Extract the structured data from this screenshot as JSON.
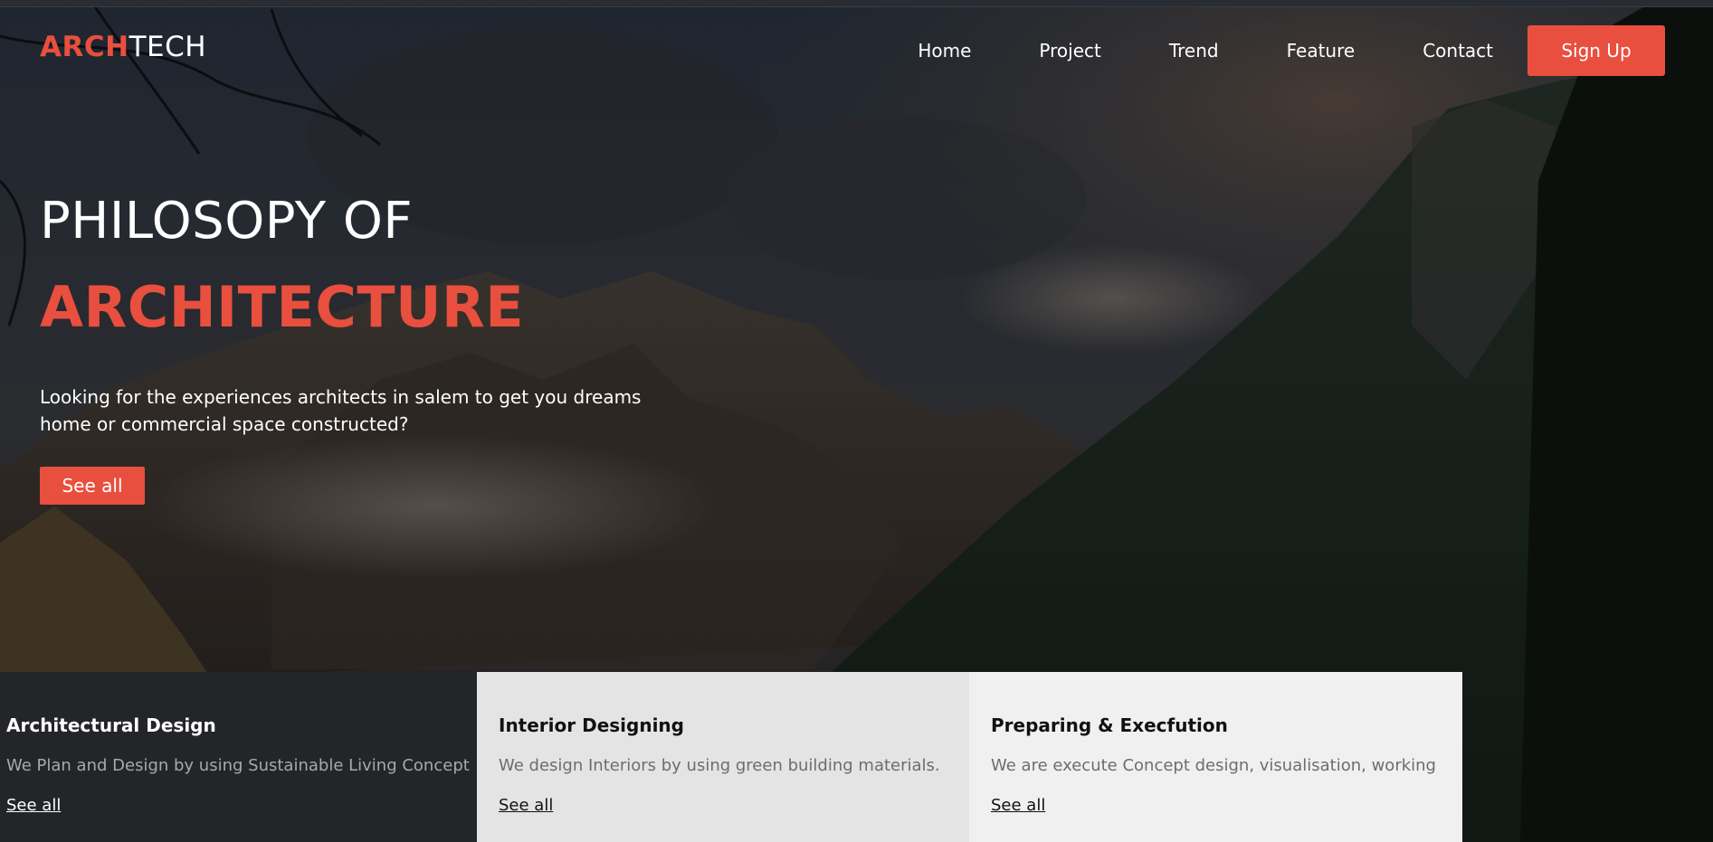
{
  "brand": {
    "accent_part": "ARCH",
    "rest_part": "TECH"
  },
  "nav": {
    "links": [
      "Home",
      "Project",
      "Trend",
      "Feature",
      "Contact"
    ],
    "signup_label": "Sign Up"
  },
  "hero": {
    "title_line1": "PHILOSOPY OF",
    "title_line2": "ARCHITECTURE",
    "description": "Looking for the experiences architects in salem to get you dreams home or commercial space constructed?",
    "button_label": "See all"
  },
  "services": [
    {
      "title": "Architectural Design",
      "text": "We Plan and Design by using Sustainable Living Concept",
      "link": "See all"
    },
    {
      "title": "Interior Designing",
      "text": "We design Interiors by using green building materials.",
      "link": "See all"
    },
    {
      "title": "Preparing & Execfution",
      "text": "We are execute Concept design, visualisation, working",
      "link": "See all"
    }
  ],
  "colors": {
    "accent": "#e94f3e",
    "dark_card": "#232529",
    "light_card": "#e4e4e4",
    "lighter_card": "#f0f0f0"
  }
}
